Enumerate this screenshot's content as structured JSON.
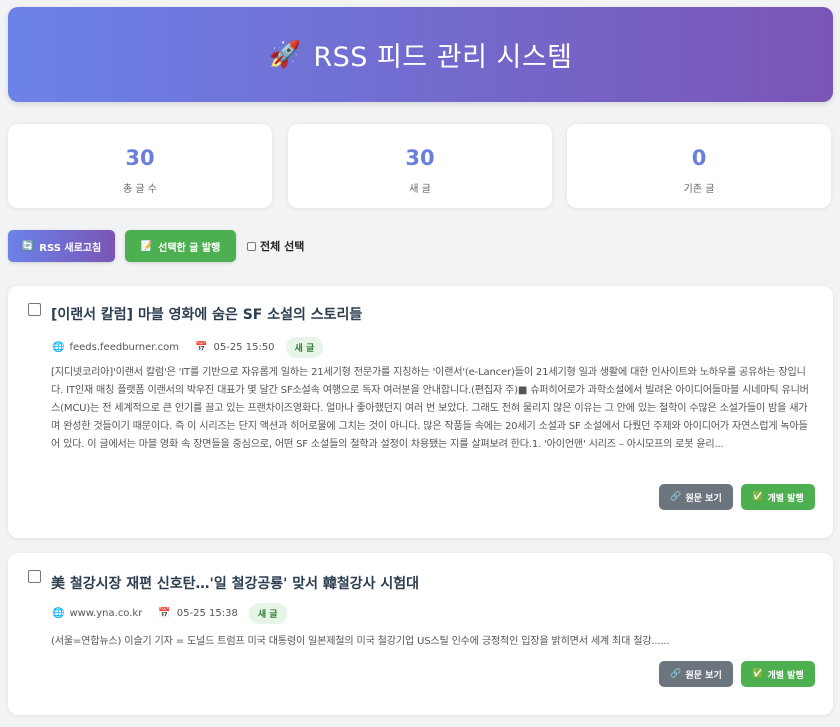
{
  "header": {
    "icon": "🚀",
    "title": "RSS 피드 관리 시스템"
  },
  "stats": [
    {
      "value": "30",
      "label": "총 글 수"
    },
    {
      "value": "30",
      "label": "새 글"
    },
    {
      "value": "0",
      "label": "기존 글"
    }
  ],
  "toolbar": {
    "refresh_icon": "🔄",
    "refresh_label": "RSS 새로고침",
    "publish_icon": "📝",
    "publish_label": "선택한 글 발행",
    "select_all_label": "전체 선택"
  },
  "articles": [
    {
      "title": "[이랜서 칼럼] 마블 영화에 숨은 SF 소설의 스토리들",
      "source": "feeds.feedburner.com",
      "date": "05-25 15:50",
      "badge": "새 글",
      "summary": "[지디넷코리아]'이랜서 칼럼'은 'IT를 기반으로 자유롭게 일하는 21세기형 전문가를 지칭하는 '이랜서'(e-Lancer)들이 21세기형 일과 생활에 대한 인사이트와 노하우를 공유하는 장입니다. IT인재 매칭 플랫폼 이랜서의 박우진 대표가 몇 달간 SF소설속 여행으로 독자 여러분을 안내합니다.(편집자 주)■ 슈퍼히어로가 과학소설에서 빌려온 아이디어들마블 시네마틱 유니버스(MCU)는 전 세계적으로 큰 인기를 끌고 있는 프랜차이즈영화다. 얼마나 좋아했던지 여러 번 보았다. 그래도 전혀 물리지 않은 이유는 그 안에 있는 철학이 수많은 소설가들이 밤을 새가며 완성한 것들이기 때문이다. 즉 이 시리즈는 단지 액션과 히어로물에 그치는 것이 아니다. 많은 작품들 속에는 20세기 소설과 SF 소설에서 다뤘던 주제와 아이디어가 자연스럽게 녹아들어 있다. 이 글에서는 마블 영화 속 장면들을 중심으로, 어떤 SF 소설들의 철학과 설정이 차용됐는 지를 살펴보려 한다.1. '아이언맨' 시리즈 – 아시모프의 로봇 윤리...",
      "view_label": "원문 보기",
      "publish_label": "개별 발행"
    },
    {
      "title": "美 철강시장 재편 신호탄…'일 철강공룡' 맞서 韓철강사 시험대",
      "source": "www.yna.co.kr",
      "date": "05-25 15:38",
      "badge": "새 글",
      "summary": "(서울=연합뉴스) 이슬기 기자 = 도널드 트럼프 미국 대통령이 일본제철의 미국 철강기업 US스틸 인수에 긍정적인 입장을 밝히면서 세계 최대 철강......",
      "view_label": "원문 보기",
      "publish_label": "개별 발행"
    }
  ],
  "icons": {
    "globe": "🌐",
    "calendar": "📅",
    "link": "🔗",
    "check": "✅"
  }
}
